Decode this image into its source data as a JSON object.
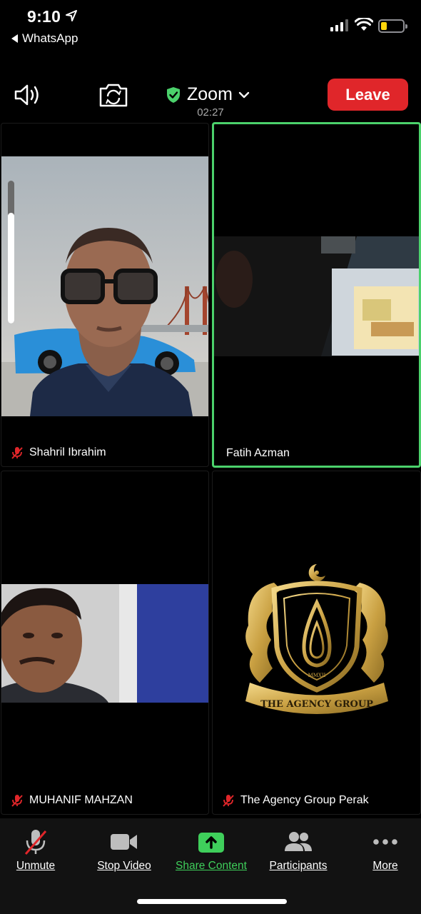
{
  "status_bar": {
    "time": "9:10",
    "back_app": "WhatsApp",
    "battery_color": "#ffd60a"
  },
  "meeting_bar": {
    "title": "Zoom",
    "timer": "02:27",
    "leave_label": "Leave",
    "leave_color": "#e0262a",
    "secure_color": "#4bd16b"
  },
  "participants": [
    {
      "name": "Shahril Ibrahim",
      "muted": true,
      "video": "on"
    },
    {
      "name": "Fatih Azman",
      "muted": false,
      "video": "on",
      "active_speaker": true
    },
    {
      "name": "MUHANIF MAHZAN",
      "muted": true,
      "video": "on"
    },
    {
      "name": "The Agency Group Perak",
      "muted": true,
      "video": "logo"
    }
  ],
  "logo": {
    "year_text": "MMXII",
    "banner_text": "THE AGENCY GROUP"
  },
  "toolbar": {
    "items": [
      {
        "label": "Unmute",
        "icon": "mic-muted-icon"
      },
      {
        "label": "Stop Video",
        "icon": "video-camera-icon"
      },
      {
        "label": "Share Content",
        "icon": "share-screen-icon"
      },
      {
        "label": "Participants",
        "icon": "participants-icon"
      },
      {
        "label": "More",
        "icon": "more-dots-icon"
      }
    ]
  }
}
